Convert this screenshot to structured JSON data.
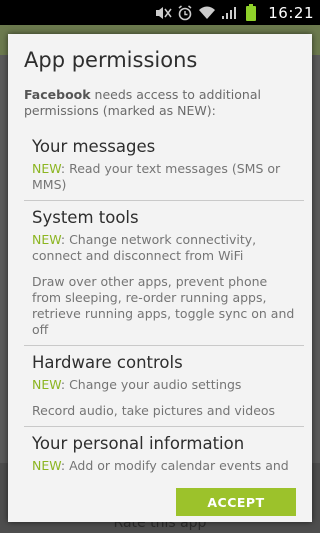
{
  "status_bar": {
    "time": "16:21"
  },
  "background": {
    "rate_label": "Rate this app"
  },
  "dialog": {
    "title": "App permissions",
    "intro_app": "Facebook",
    "intro_rest": " needs access to additional permissions (marked as NEW):",
    "new_label": "NEW",
    "sections": [
      {
        "title": "Your messages",
        "new_perm": ": Read your text messages (SMS or MMS)",
        "existing": ""
      },
      {
        "title": "System tools",
        "new_perm": ": Change network connectivity, connect and disconnect from WiFi",
        "existing": "Draw over other apps, prevent phone from sleeping, re-order running apps, retrieve running apps, toggle sync on and off"
      },
      {
        "title": "Hardware controls",
        "new_perm": ": Change your audio settings",
        "existing": "Record audio, take pictures and videos"
      },
      {
        "title": "Your personal information",
        "new_perm": ": Add or modify calendar events and",
        "existing": ""
      }
    ],
    "accept_label": "ACCEPT"
  },
  "colors": {
    "accent": "#9cc22b",
    "new_text": "#8cb521"
  }
}
